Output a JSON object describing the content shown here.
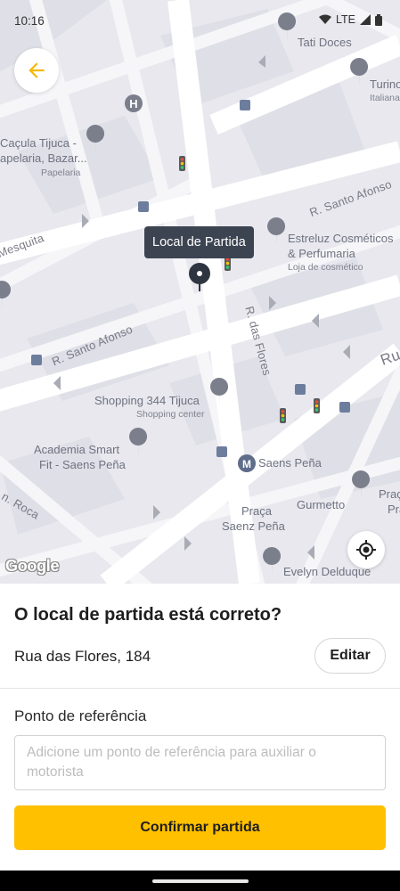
{
  "status_bar": {
    "time": "10:16",
    "network": "LTE"
  },
  "map": {
    "tooltip": "Local de Partida",
    "attribution": "Google",
    "streets": {
      "santo_afonso_1": "R. Santo Afonso",
      "santo_afonso_2": "R. Santo Afonso",
      "das_flores": "R. das Flores",
      "mesquita": "Mesquita",
      "roca": "n. Roca",
      "rua_partial": "Rua"
    },
    "pois": {
      "tati_doces": "Tati Doces",
      "turino_1": "Turino",
      "turino_2": "Italiana",
      "cacula_1": "Caçula Tijuca -",
      "cacula_2": "apelaria, Bazar...",
      "cacula_sub": "Papelaria",
      "estreluz_1": "Estreluz Cosméticos",
      "estreluz_2": "& Perfumaria",
      "estreluz_sub": "Loja de cosmético",
      "shopping_1": "Shopping 344 Tijuca",
      "shopping_sub": "Shopping center",
      "academia_1": "Academia Smart",
      "academia_2": "Fit - Saens Peña",
      "saens_pena": "Saens Peña",
      "gurmetto": "Gurmetto",
      "praca_1": "Praça",
      "praca_2": "Saenz Peña",
      "evelyn": "Evelyn Delduque",
      "prac_partial": "Praç",
      "pra_partial": "Pra"
    }
  },
  "sheet": {
    "question": "O local de partida está correto?",
    "address": "Rua das Flores, 184",
    "edit_label": "Editar",
    "reference_title": "Ponto de referência",
    "reference_placeholder": "Adicione um ponto de referência para auxiliar o motorista",
    "confirm_label": "Confirmar partida"
  },
  "icons": {
    "back": "arrow-left-icon",
    "locate": "my-location-icon",
    "pin": "map-pin-icon"
  },
  "colors": {
    "accent": "#ffc000",
    "back_arrow": "#f5b800",
    "tooltip_bg": "#3d4451"
  }
}
